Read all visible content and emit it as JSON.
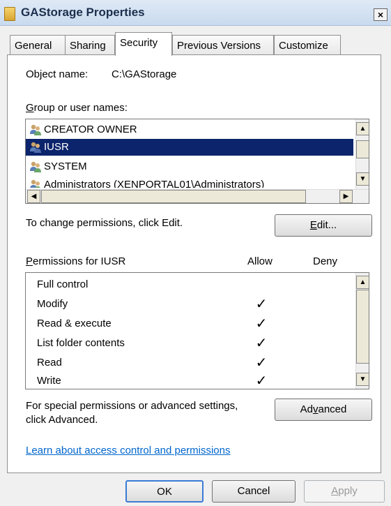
{
  "window": {
    "title": "GAStorage Properties",
    "close_label": "×"
  },
  "tabs": [
    {
      "label": "General"
    },
    {
      "label": "Sharing"
    },
    {
      "label": "Security"
    },
    {
      "label": "Previous Versions"
    },
    {
      "label": "Customize"
    }
  ],
  "security": {
    "object_name_label": "Object name:",
    "object_name_value": "C:\\GAStorage",
    "group_label_u": "G",
    "group_label_rest": "roup or user names:",
    "users": [
      {
        "name": "CREATOR OWNER",
        "selected": false
      },
      {
        "name": "IUSR",
        "selected": true
      },
      {
        "name": "SYSTEM",
        "selected": false
      },
      {
        "name": "Administrators (XENPORTAL01\\Administrators)",
        "selected": false
      }
    ],
    "change_hint": "To change permissions, click Edit.",
    "edit_u": "E",
    "edit_rest": "dit...",
    "perm_label_u": "P",
    "perm_label_rest": "ermissions for IUSR",
    "allow_header": "Allow",
    "deny_header": "Deny",
    "permissions": [
      {
        "name": "Full control",
        "allow": "",
        "deny": ""
      },
      {
        "name": "Modify",
        "allow": "✓",
        "deny": ""
      },
      {
        "name": "Read & execute",
        "allow": "✓",
        "deny": ""
      },
      {
        "name": "List folder contents",
        "allow": "✓",
        "deny": ""
      },
      {
        "name": "Read",
        "allow": "✓",
        "deny": ""
      },
      {
        "name": "Write",
        "allow": "✓",
        "deny": ""
      }
    ],
    "special_line1": "For special permissions or advanced settings,",
    "special_line2": "click Advanced.",
    "advanced_pre": "Ad",
    "advanced_u": "v",
    "advanced_post": "anced",
    "learn_link": "Learn about access control and permissions"
  },
  "buttons": {
    "ok": "OK",
    "cancel": "Cancel",
    "apply_u": "A",
    "apply_rest": "pply"
  },
  "colors": {
    "selection": "#0b246b",
    "link": "#0066cc"
  }
}
